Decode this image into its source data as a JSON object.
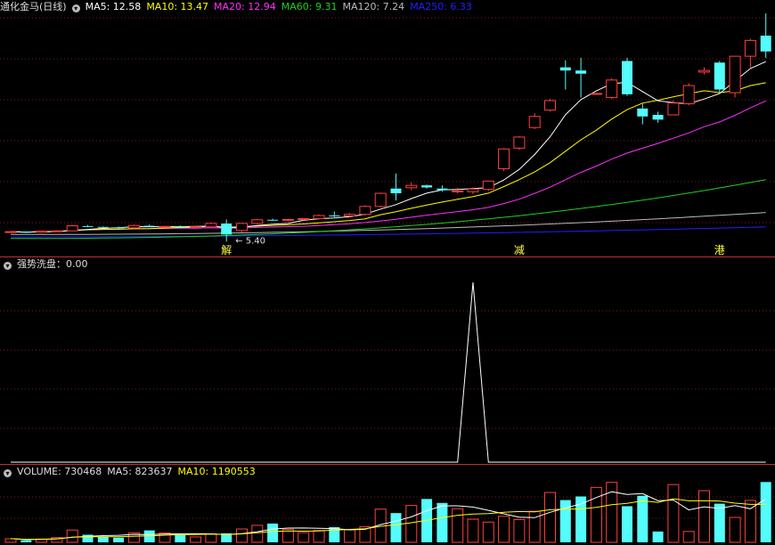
{
  "colors": {
    "up": "#ff4040",
    "down": "#54fcfc",
    "ma5": "#ffffff",
    "ma10": "#ffff00",
    "ma20": "#ff30ff",
    "ma60": "#20d020",
    "ma120": "#bbbbbb",
    "ma250": "#2020ff",
    "grid": "#7a1e1e",
    "separator": "#c03030",
    "label_gray": "#dddddd"
  },
  "main": {
    "title": "通化金马(日线)",
    "ma_labels": [
      {
        "key": "ma5",
        "text": "MA5: 12.58"
      },
      {
        "key": "ma10",
        "text": "MA10: 13.47"
      },
      {
        "key": "ma20",
        "text": "MA20: 12.94"
      },
      {
        "key": "ma60",
        "text": "MA60: 9.31"
      },
      {
        "key": "ma120",
        "text": "MA120: 7.24"
      },
      {
        "key": "ma250",
        "text": "MA250: 6.33"
      }
    ],
    "low_annotation": "← 5.40",
    "markers": [
      {
        "index": 14,
        "text": "解"
      },
      {
        "index": 33,
        "text": "减"
      },
      {
        "index": 46,
        "text": "港"
      }
    ]
  },
  "indicator": {
    "label": "强势洗盘：0.00"
  },
  "volume": {
    "label": "VOLUME: 730468",
    "ma5_label": "MA5: 823637",
    "ma10_label": "MA10: 1190553"
  },
  "chart_data": [
    {
      "type": "candlestick",
      "title": "通化金马(日线)",
      "ylim": [
        4.8,
        20.2
      ],
      "candles": [
        [
          6.02,
          6.05,
          5.98,
          6.03
        ],
        [
          6.02,
          6.04,
          5.95,
          5.98
        ],
        [
          5.99,
          6.08,
          5.97,
          6.06
        ],
        [
          6.05,
          6.12,
          6.02,
          6.08
        ],
        [
          6.08,
          6.45,
          6.05,
          6.4
        ],
        [
          6.38,
          6.45,
          6.3,
          6.34
        ],
        [
          6.33,
          6.36,
          6.25,
          6.3
        ],
        [
          6.3,
          6.35,
          6.2,
          6.28
        ],
        [
          6.27,
          6.48,
          6.22,
          6.42
        ],
        [
          6.4,
          6.47,
          6.32,
          6.35
        ],
        [
          6.34,
          6.4,
          6.28,
          6.36
        ],
        [
          6.36,
          6.42,
          6.28,
          6.31
        ],
        [
          6.31,
          6.38,
          6.25,
          6.34
        ],
        [
          6.33,
          6.62,
          6.28,
          6.55
        ],
        [
          6.54,
          6.8,
          5.4,
          5.85
        ],
        [
          6.1,
          6.58,
          6.0,
          6.55
        ],
        [
          6.55,
          6.85,
          6.5,
          6.78
        ],
        [
          6.78,
          6.85,
          6.7,
          6.75
        ],
        [
          6.75,
          6.82,
          6.68,
          6.8
        ],
        [
          6.8,
          6.88,
          6.72,
          6.85
        ],
        [
          6.85,
          7.12,
          6.8,
          7.05
        ],
        [
          7.05,
          7.3,
          6.95,
          7.02
        ],
        [
          7.02,
          7.2,
          6.95,
          7.12
        ],
        [
          7.12,
          7.7,
          7.05,
          7.62
        ],
        [
          7.62,
          8.5,
          7.55,
          8.45
        ],
        [
          8.75,
          9.7,
          8.0,
          8.45
        ],
        [
          8.8,
          9.15,
          8.65,
          8.95
        ],
        [
          8.95,
          9.0,
          8.75,
          8.82
        ],
        [
          8.75,
          8.95,
          8.55,
          8.65
        ],
        [
          8.6,
          8.8,
          8.45,
          8.6
        ],
        [
          8.55,
          8.82,
          8.4,
          8.72
        ],
        [
          8.7,
          9.25,
          8.6,
          9.22
        ],
        [
          10.0,
          11.3,
          9.85,
          11.25
        ],
        [
          11.3,
          12.05,
          11.2,
          12.0
        ],
        [
          12.6,
          13.5,
          12.5,
          13.3
        ],
        [
          13.7,
          14.4,
          13.6,
          14.3
        ],
        [
          16.4,
          16.85,
          15.0,
          16.2
        ],
        [
          16.2,
          17.0,
          14.5,
          16.0
        ],
        [
          14.75,
          14.8,
          14.7,
          14.75
        ],
        [
          14.5,
          15.7,
          14.4,
          15.6
        ],
        [
          16.8,
          17.0,
          14.6,
          14.7
        ],
        [
          13.8,
          14.1,
          12.8,
          13.3
        ],
        [
          13.4,
          13.6,
          12.9,
          13.1
        ],
        [
          13.4,
          14.3,
          13.4,
          14.15
        ],
        [
          14.1,
          15.4,
          14.0,
          15.25
        ],
        [
          16.1,
          16.4,
          15.95,
          16.2
        ],
        [
          16.7,
          16.8,
          14.8,
          15.0
        ],
        [
          14.8,
          17.0,
          14.5,
          17.1
        ],
        [
          17.1,
          18.2,
          16.4,
          18.1
        ],
        [
          18.4,
          19.8,
          17.0,
          17.4
        ]
      ],
      "ma_latest": {
        "ma5": 12.58,
        "ma10": 13.47,
        "ma20": 12.94,
        "ma60": 9.31,
        "ma120": 7.24,
        "ma250": 6.33
      },
      "low_marker": 5.4
    },
    {
      "type": "line",
      "title": "强势洗盘",
      "ylim": [
        0,
        1.05
      ],
      "values": [
        0,
        0,
        0,
        0,
        0,
        0,
        0,
        0,
        0,
        0,
        0,
        0,
        0,
        0,
        0,
        0,
        0,
        0,
        0,
        0,
        0,
        0,
        0,
        0,
        0,
        0,
        0,
        0,
        0,
        0,
        1,
        0,
        0,
        0,
        0,
        0,
        0,
        0,
        0,
        0,
        0,
        0,
        0,
        0,
        0,
        0,
        0,
        0,
        0,
        0
      ]
    },
    {
      "type": "bar",
      "title": "VOLUME",
      "ylim": [
        0,
        1800000
      ],
      "values": [
        100000,
        60000,
        90000,
        130000,
        340000,
        210000,
        160000,
        130000,
        260000,
        330000,
        260000,
        200000,
        150000,
        230000,
        250000,
        370000,
        470000,
        520000,
        360000,
        270000,
        330000,
        420000,
        350000,
        430000,
        920000,
        810000,
        1020000,
        1200000,
        1090000,
        930000,
        640000,
        560000,
        720000,
        630000,
        860000,
        1380000,
        1170000,
        1270000,
        1520000,
        1660000,
        1000000,
        1290000,
        300000,
        1600000,
        300000,
        1430000,
        1070000,
        690000,
        1160000,
        1670000
      ],
      "ma_latest": {
        "ma5": 823637,
        "ma10": 1190553
      }
    }
  ]
}
